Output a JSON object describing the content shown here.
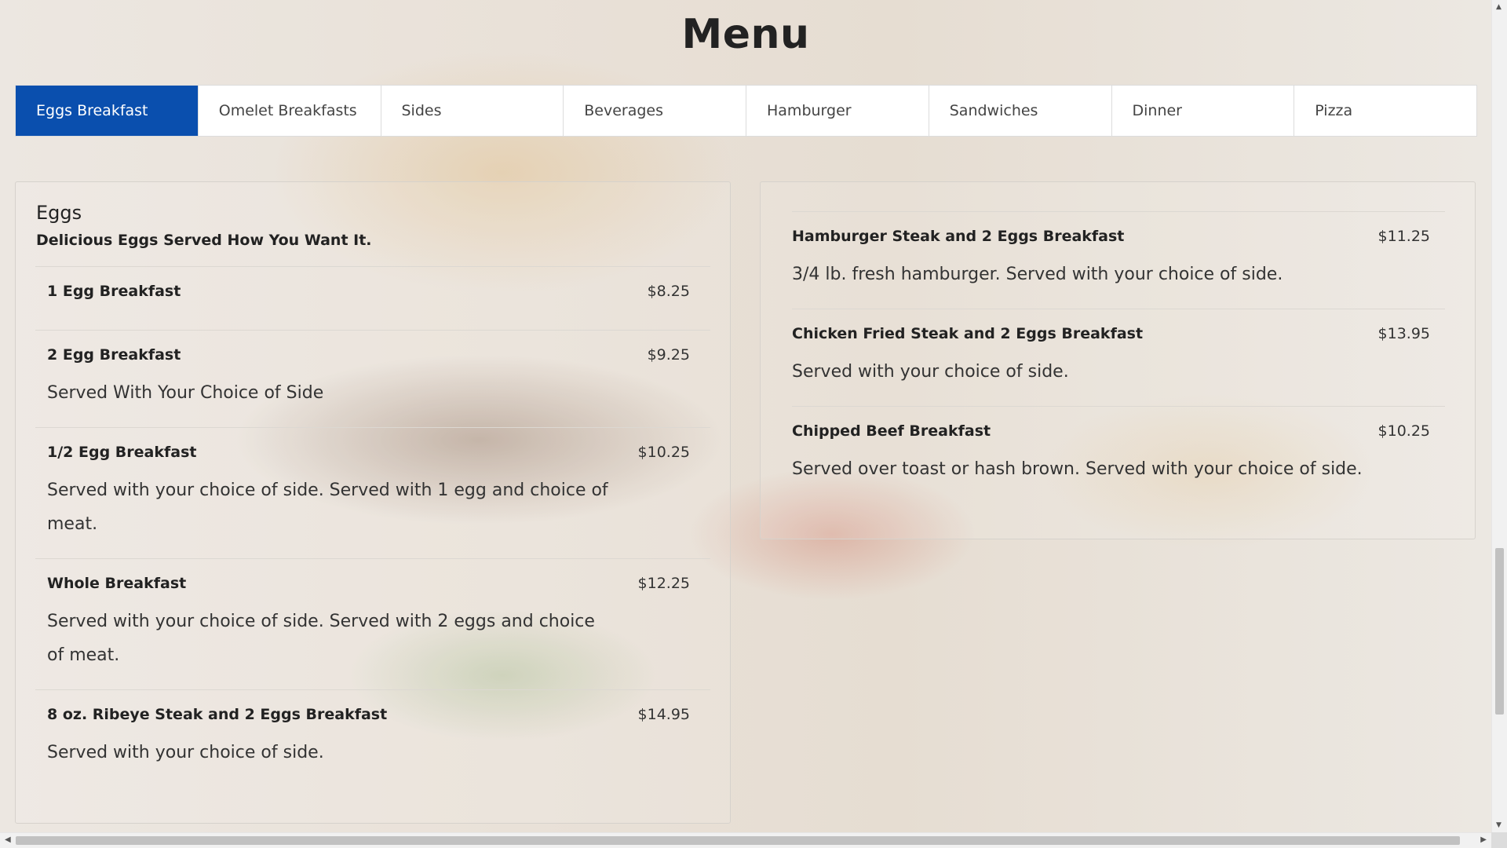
{
  "page": {
    "title": "Menu"
  },
  "tabs": [
    {
      "label": "Eggs Breakfast",
      "active": true
    },
    {
      "label": "Omelet Breakfasts"
    },
    {
      "label": "Sides"
    },
    {
      "label": "Beverages"
    },
    {
      "label": "Hamburger"
    },
    {
      "label": "Sandwiches"
    },
    {
      "label": "Dinner"
    },
    {
      "label": "Pizza"
    }
  ],
  "section": {
    "title": "Eggs",
    "subtitle": "Delicious Eggs Served How You Want It."
  },
  "left_items": [
    {
      "name": "1 Egg Breakfast",
      "price": "$8.25",
      "description": ""
    },
    {
      "name": "2 Egg Breakfast",
      "price": "$9.25",
      "description": "Served With Your Choice of Side"
    },
    {
      "name": "1/2 Egg Breakfast",
      "price": "$10.25",
      "description": "Served with your choice of side. Served with 1 egg and choice of meat."
    },
    {
      "name": "Whole Breakfast",
      "price": "$12.25",
      "description": "Served with your choice of side. Served with 2 eggs and choice of meat."
    },
    {
      "name": "8 oz. Ribeye Steak and 2 Eggs Breakfast",
      "price": "$14.95",
      "description": "Served with your choice of side."
    }
  ],
  "right_items": [
    {
      "name": "Hamburger Steak and 2 Eggs Breakfast",
      "price": "$11.25",
      "description": "3/4 lb. fresh hamburger. Served with your choice of side."
    },
    {
      "name": "Chicken Fried Steak and 2 Eggs Breakfast",
      "price": "$13.95",
      "description": "Served with your choice of side."
    },
    {
      "name": "Chipped Beef Breakfast",
      "price": "$10.25",
      "description": "Served over toast or hash brown. Served with your choice of side."
    }
  ],
  "colors": {
    "active_tab": "#0a4fae"
  }
}
